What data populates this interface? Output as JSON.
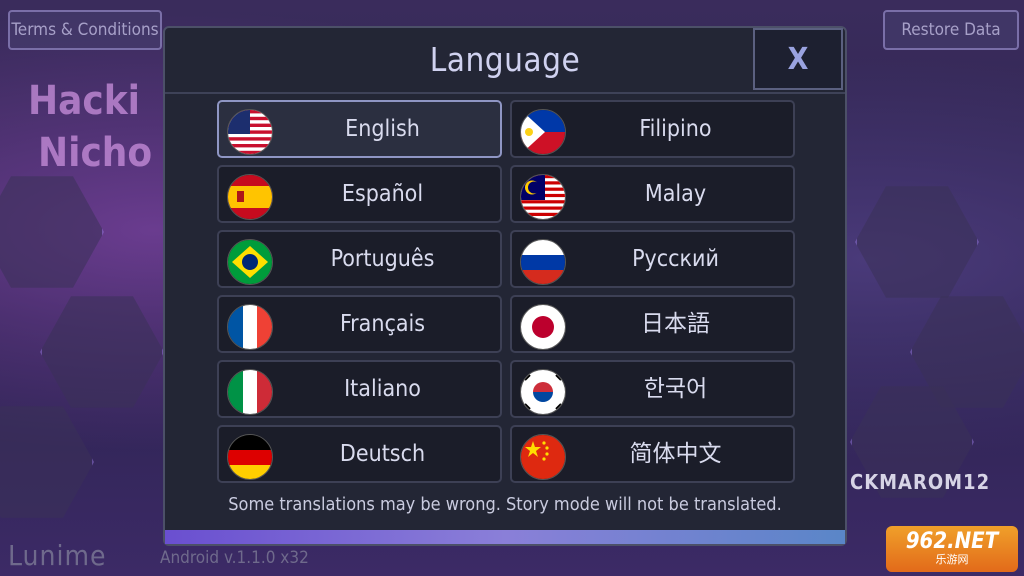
{
  "top_bar": {
    "left_button": "Terms & Conditions",
    "right_button": "Restore Data"
  },
  "background": {
    "brand": "Lunime",
    "version": "Android v.1.1.0 x32",
    "left_art_text": "Hacki",
    "left_art_text2": "Nicho",
    "right_tag": "CKMAROM12"
  },
  "watermark": {
    "number": "962.NET",
    "sub": "乐游网"
  },
  "dialog": {
    "title": "Language",
    "close_label": "X",
    "note": "Some translations may be wrong. Story mode will not be translated.",
    "languages": [
      {
        "label": "English",
        "flag": "us-flag-icon",
        "selected": true
      },
      {
        "label": "Filipino",
        "flag": "philippines-flag-icon",
        "selected": false
      },
      {
        "label": "Español",
        "flag": "spain-flag-icon",
        "selected": false
      },
      {
        "label": "Malay",
        "flag": "malaysia-flag-icon",
        "selected": false
      },
      {
        "label": "Português",
        "flag": "brazil-flag-icon",
        "selected": false
      },
      {
        "label": "Русский",
        "flag": "russia-flag-icon",
        "selected": false
      },
      {
        "label": "Français",
        "flag": "france-flag-icon",
        "selected": false
      },
      {
        "label": "日本語",
        "flag": "japan-flag-icon",
        "selected": false
      },
      {
        "label": "Italiano",
        "flag": "italy-flag-icon",
        "selected": false
      },
      {
        "label": "한국어",
        "flag": "korea-flag-icon",
        "selected": false
      },
      {
        "label": "Deutsch",
        "flag": "germany-flag-icon",
        "selected": false
      },
      {
        "label": "简体中文",
        "flag": "china-flag-icon",
        "selected": false
      }
    ]
  },
  "colors": {
    "dialog_bg": "#232635",
    "button_bg": "#1b1d29",
    "selected_border": "#8f96c4",
    "accent_bar": "#6a4fd0"
  }
}
